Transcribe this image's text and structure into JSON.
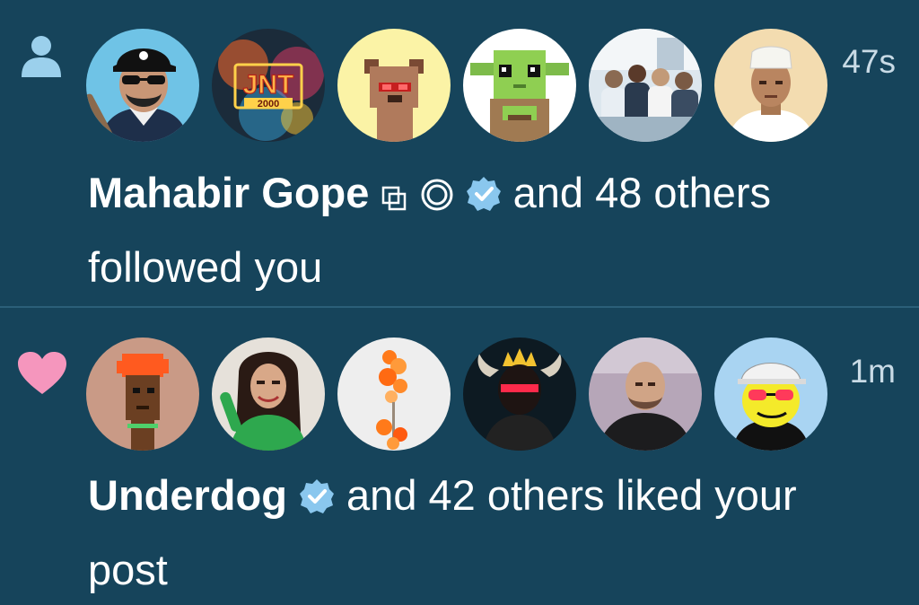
{
  "notifications": [
    {
      "kind": "follow",
      "kind_icon": "person-icon",
      "timestamp": "47s",
      "actor": "Mahabir Gope",
      "actor_badges": [
        "square-stack-icon",
        "ring-icon",
        "verified-badge-icon"
      ],
      "rest_text": " and 48 others followed you",
      "avatars": [
        "avatar-cartoon-man-cap-sunglasses",
        "avatar-jnt-2000-logo",
        "avatar-pixel-dog-red-glasses",
        "avatar-pixel-green-alien",
        "avatar-office-group-photo",
        "avatar-man-white-cap"
      ]
    },
    {
      "kind": "like",
      "kind_icon": "heart-icon",
      "timestamp": "1m",
      "actor": "Underdog",
      "actor_badges": [
        "verified-badge-icon"
      ],
      "rest_text": " and 42 others liked your post",
      "avatars": [
        "avatar-pixel-punk-orange-hair",
        "avatar-woman-green-top",
        "avatar-orange-flowers",
        "avatar-horned-crown-figure",
        "avatar-bald-man-black-shirt",
        "avatar-yellow-face-cap-sunglasses"
      ]
    }
  ],
  "colors": {
    "background": "#16445b",
    "divider": "#2b5f79",
    "text": "#ffffff",
    "timestamp": "#c9dbe6",
    "follow_icon": "#9bd0ec",
    "heart": "#f596bd",
    "verified": "#8ac7ee"
  }
}
